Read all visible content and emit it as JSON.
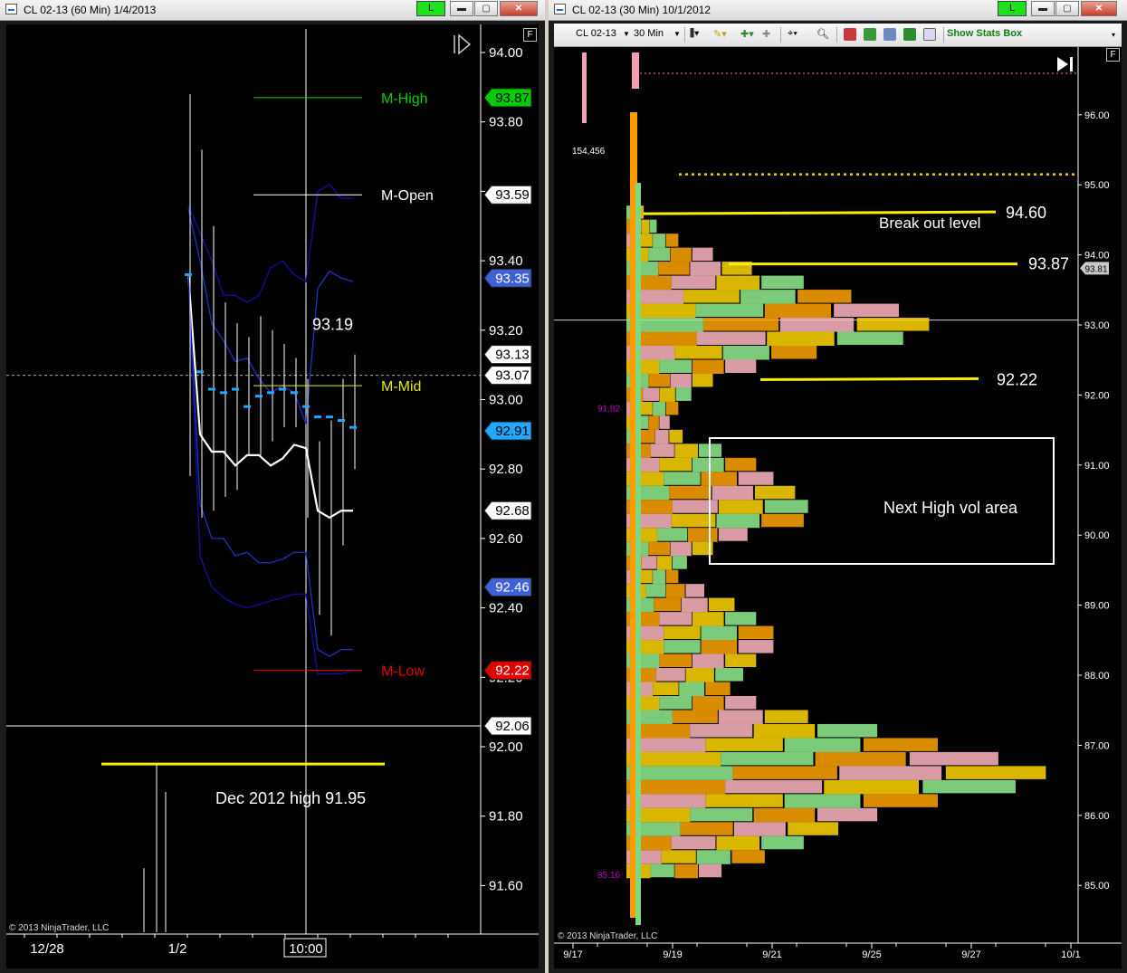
{
  "left_window": {
    "title": "CL 02-13 (60 Min)  1/4/2013",
    "connection_label": "L",
    "btn_minimize": "▬",
    "btn_maximize": "▢",
    "btn_close": "✕",
    "f_label": "F",
    "copyright": "© 2013 NinjaTrader, LLC"
  },
  "right_window": {
    "title": "CL 02-13 (30 Min)  10/1/2012",
    "connection_label": "L",
    "btn_minimize": "▬",
    "btn_maximize": "▢",
    "btn_close": "✕",
    "instrument": "CL 02-13",
    "interval": "30 Min",
    "show_stats": "Show Stats Box",
    "f_label": "F",
    "copyright": "© 2013 NinjaTrader, LLC"
  },
  "chart_data": [
    {
      "type": "line",
      "panel": "left",
      "y_ticks": [
        "94.00",
        "93.80",
        "93.60",
        "93.40",
        "93.20",
        "93.00",
        "92.80",
        "92.60",
        "92.40",
        "92.20",
        "92.00",
        "91.80",
        "91.60"
      ],
      "x_ticks": [
        "12/28",
        "1/2",
        "10:00"
      ],
      "levels": [
        {
          "label": "M-High",
          "value": 93.87,
          "color": "#00d000"
        },
        {
          "label": "M-Open",
          "value": 93.59,
          "color": "#ffffff"
        },
        {
          "label": "M-Mid",
          "value": 93.04,
          "color": "#e8e800"
        },
        {
          "label": "M-Low",
          "value": 92.22,
          "color": "#e00000"
        }
      ],
      "price_markers": [
        {
          "text": "93.87",
          "value": 93.87,
          "bg": "#00cc00",
          "fg": "#000000"
        },
        {
          "text": "93.59",
          "value": 93.59,
          "bg": "#ffffff",
          "fg": "#000000"
        },
        {
          "text": "93.35",
          "value": 93.35,
          "bg": "#4060d8",
          "fg": "#ffffff"
        },
        {
          "text": "93.13",
          "value": 93.13,
          "bg": "#ffffff",
          "fg": "#000000"
        },
        {
          "text": "93.07",
          "value": 93.07,
          "bg": "#ffffff",
          "fg": "#000000"
        },
        {
          "text": "92.91",
          "value": 92.91,
          "bg": "#1ea8ff",
          "fg": "#000000"
        },
        {
          "text": "92.68",
          "value": 92.68,
          "bg": "#ffffff",
          "fg": "#000000"
        },
        {
          "text": "92.46",
          "value": 92.46,
          "bg": "#4060d8",
          "fg": "#ffffff"
        },
        {
          "text": "92.22",
          "value": 92.22,
          "bg": "#e00000",
          "fg": "#ffffff"
        },
        {
          "text": "92.06",
          "value": 92.06,
          "bg": "#ffffff",
          "fg": "#000000"
        }
      ],
      "annotations": [
        {
          "text": "93.19"
        },
        {
          "text": "Dec 2012 high 91.95",
          "value": 91.95
        }
      ],
      "series": [
        {
          "role": "upper band",
          "color": "#1010a0",
          "values": [
            93.56,
            93.48,
            93.4,
            93.3,
            93.3,
            93.28,
            93.3,
            93.38,
            93.4,
            93.36,
            93.34,
            93.6,
            93.62,
            93.58,
            93.58
          ]
        },
        {
          "role": "upper middle band",
          "color": "#2030c0",
          "values": [
            93.55,
            93.4,
            93.22,
            93.17,
            93.11,
            93.12,
            93.06,
            93.02,
            93.04,
            93.02,
            92.93,
            93.32,
            93.37,
            93.35,
            93.34
          ]
        },
        {
          "role": "middle line",
          "color": "#ffffff",
          "values": [
            93.36,
            92.9,
            92.85,
            92.85,
            92.81,
            92.84,
            92.84,
            92.81,
            92.83,
            92.87,
            92.86,
            92.68,
            92.66,
            92.68,
            92.68
          ]
        },
        {
          "role": "lower middle band",
          "color": "#2030c0",
          "values": [
            93.36,
            92.7,
            92.6,
            92.6,
            92.55,
            92.56,
            92.53,
            92.53,
            92.54,
            92.56,
            92.56,
            92.28,
            92.26,
            92.28,
            92.28
          ]
        },
        {
          "role": "lower band",
          "color": "#1010a0",
          "values": [
            93.36,
            92.55,
            92.46,
            92.43,
            92.41,
            92.4,
            92.41,
            92.42,
            92.43,
            92.44,
            92.44,
            92.21,
            92.21,
            92.21,
            92.22
          ]
        }
      ],
      "bars": [
        {
          "high": 93.88,
          "low": 92.78
        },
        {
          "high": 93.72,
          "low": 92.66
        },
        {
          "high": 93.5,
          "low": 92.68
        },
        {
          "high": 93.28,
          "low": 92.72
        },
        {
          "high": 93.22,
          "low": 92.74
        },
        {
          "high": 93.18,
          "low": 92.84
        },
        {
          "high": 93.24,
          "low": 92.84
        },
        {
          "high": 93.2,
          "low": 92.88
        },
        {
          "high": 93.16,
          "low": 92.92
        },
        {
          "high": 93.12,
          "low": 92.92
        },
        {
          "high": 93.06,
          "low": 92.66
        },
        {
          "high": 92.88,
          "low": 92.38
        },
        {
          "high": 92.94,
          "low": 92.32
        },
        {
          "high": 93.06,
          "low": 92.58
        },
        {
          "high": 93.13,
          "low": 92.8
        }
      ],
      "ticks_markers": [
        93.36,
        93.08,
        93.03,
        93.02,
        93.03,
        92.98,
        93.01,
        93.02,
        93.03,
        93.02,
        92.98,
        92.95,
        92.95,
        92.94,
        92.92
      ]
    },
    {
      "type": "bar",
      "panel": "right",
      "y_ticks": [
        "96.00",
        "95.00",
        "94.00",
        "93.00",
        "92.00",
        "91.00",
        "90.00",
        "89.00",
        "88.00",
        "87.00",
        "86.00",
        "85.00"
      ],
      "x_ticks": [
        "9/17",
        "9/19",
        "9/21",
        "9/25",
        "9/27",
        "10/1"
      ],
      "current_price": {
        "text": "93.81",
        "value": 93.81
      },
      "labels": [
        {
          "text": "154,456"
        },
        {
          "text": "91.82",
          "value": 91.82,
          "color": "#c000c0"
        },
        {
          "text": "85.16",
          "value": 85.16,
          "color": "#c000c0"
        }
      ],
      "annotations": [
        {
          "text": "Break out level"
        },
        {
          "text": "94.60",
          "value": 94.6
        },
        {
          "text": "93.87",
          "value": 93.87
        },
        {
          "text": "92.22",
          "value": 92.22
        },
        {
          "text": "Next High vol area"
        }
      ],
      "profile": {
        "prices": [
          94.6,
          94.4,
          94.2,
          94.0,
          93.8,
          93.6,
          93.4,
          93.2,
          93.0,
          92.8,
          92.6,
          92.4,
          92.2,
          92.0,
          91.8,
          91.6,
          91.4,
          91.2,
          91.0,
          90.8,
          90.6,
          90.4,
          90.2,
          90.0,
          89.8,
          89.6,
          89.4,
          89.2,
          89.0,
          88.8,
          88.6,
          88.4,
          88.2,
          88.0,
          87.8,
          87.6,
          87.4,
          87.2,
          87.0,
          86.8,
          86.6,
          86.4,
          86.2,
          86.0,
          85.8,
          85.6,
          85.4,
          85.2
        ],
        "extent": [
          0.04,
          0.07,
          0.12,
          0.2,
          0.29,
          0.41,
          0.52,
          0.63,
          0.7,
          0.64,
          0.44,
          0.3,
          0.2,
          0.15,
          0.12,
          0.1,
          0.13,
          0.22,
          0.3,
          0.34,
          0.39,
          0.42,
          0.41,
          0.28,
          0.2,
          0.14,
          0.12,
          0.18,
          0.25,
          0.3,
          0.34,
          0.34,
          0.3,
          0.27,
          0.24,
          0.3,
          0.42,
          0.58,
          0.72,
          0.86,
          0.97,
          0.9,
          0.72,
          0.58,
          0.49,
          0.41,
          0.32,
          0.22
        ]
      }
    }
  ]
}
